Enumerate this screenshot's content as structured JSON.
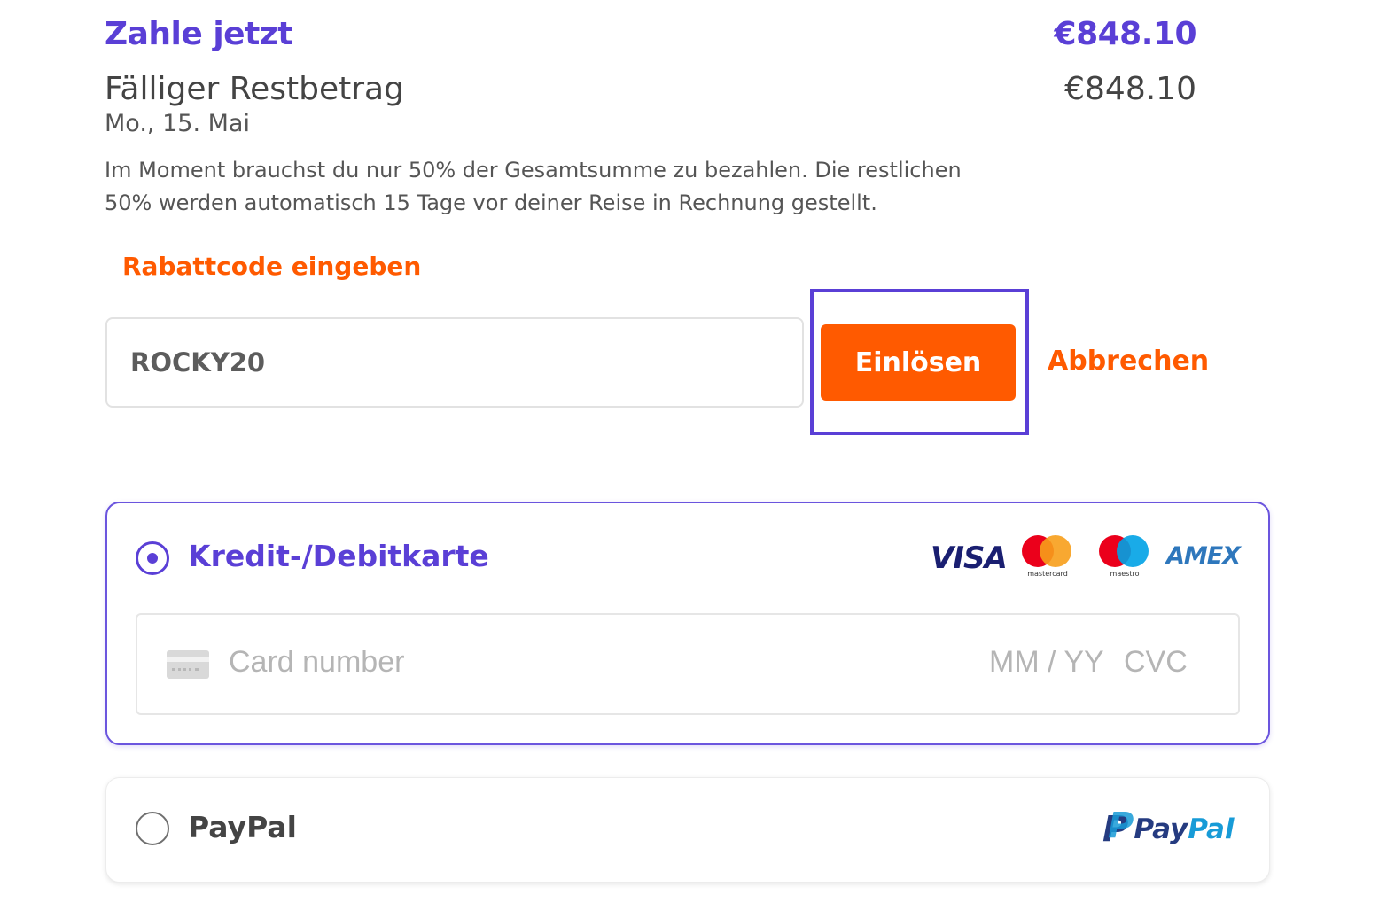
{
  "summary": {
    "pay_now_label": "Zahle jetzt",
    "pay_now_amount": "€848.10",
    "balance_label": "Fälliger Restbetrag",
    "balance_amount": "€848.10",
    "due_date": "Mo., 15. Mai",
    "info": "Im Moment brauchst du nur 50% der Gesamtsumme zu bezahlen. Die restlichen 50% werden automatisch 15 Tage vor deiner Reise in Rechnung gestellt."
  },
  "coupon": {
    "label": "Rabattcode eingeben",
    "value": "ROCKY20",
    "redeem_label": "Einlösen",
    "cancel_label": "Abbrechen"
  },
  "payment_options": {
    "card": {
      "label": "Kredit-/Debitkarte",
      "selected": true,
      "brands": {
        "visa": "VISA",
        "mastercard": "mastercard",
        "maestro": "maestro",
        "amex": "AMEX"
      },
      "number_placeholder": "Card number",
      "expiry_placeholder": "MM / YY",
      "cvc_placeholder": "CVC"
    },
    "paypal": {
      "label": "PayPal",
      "selected": false,
      "logo_part1": "Pay",
      "logo_part2": "Pal"
    }
  },
  "colors": {
    "primary_purple": "#5a3fd6",
    "accent_orange": "#ff5a00",
    "text_gray": "#444444"
  }
}
